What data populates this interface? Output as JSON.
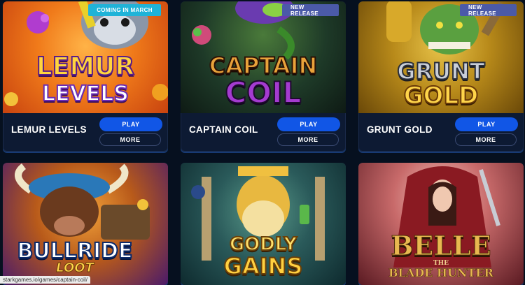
{
  "games": [
    {
      "title": "LEMUR LEVELS",
      "badge": "COMING IN MARCH",
      "badge_color": "#1fb3d8",
      "logo_line1": "LEMUR",
      "logo_line2": "LEVELS",
      "play": "PLAY",
      "more": "MORE"
    },
    {
      "title": "CAPTAIN COIL",
      "badge": "NEW RELEASE",
      "badge_color": "#4b5aa8",
      "logo_line1": "CAPTAIN",
      "logo_line2": "COIL",
      "play": "PLAY",
      "more": "MORE"
    },
    {
      "title": "GRUNT GOLD",
      "badge": "NEW RELEASE",
      "badge_color": "#4b5aa8",
      "logo_line1": "GRUNT",
      "logo_line2": "GOLD",
      "play": "PLAY",
      "more": "MORE"
    },
    {
      "logo_line1": "BULLRIDE",
      "logo_line2": "LOOT"
    },
    {
      "logo_line1": "GODLY",
      "logo_line2": "GAINS"
    },
    {
      "logo_line1": "BELLE",
      "logo_line2": "THE",
      "logo_line3": "BLADE HUNTER"
    }
  ],
  "status_bar": {
    "url": "starkgames.io/games/captain-coil/"
  },
  "colors": {
    "page_bg": "#06101f",
    "card_bg": "#0d1a33",
    "play_button": "#1156e6"
  }
}
